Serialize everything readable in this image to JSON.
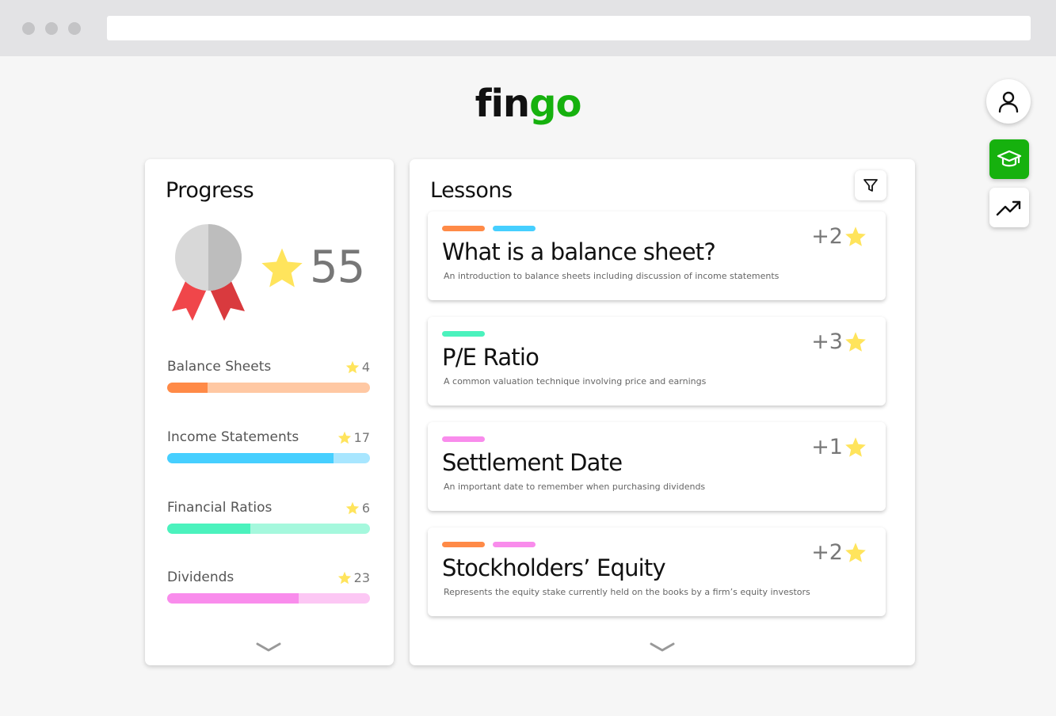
{
  "logo": {
    "part1": "fin",
    "part2": "go"
  },
  "icons": {
    "profile": "user-icon",
    "learn": "graduation-cap-icon",
    "trend": "trending-up-icon",
    "filter": "filter-icon",
    "star": "star-icon",
    "chevron": "chevron-down-icon"
  },
  "colors": {
    "brand_green": "#16b10e",
    "star": "#ffe45c",
    "balance": "#ff8a47",
    "income": "#46cfff",
    "ratios": "#4bf2bd",
    "dividends": "#f98cec"
  },
  "progress": {
    "title": "Progress",
    "score": "55",
    "categories": [
      {
        "label": "Balance Sheets",
        "count": "4",
        "fraction": 0.2,
        "color": "#ff8a47",
        "track": "#ffc8a3"
      },
      {
        "label": "Income Statements",
        "count": "17",
        "fraction": 0.82,
        "color": "#46cfff",
        "track": "#a8e6ff"
      },
      {
        "label": "Financial Ratios",
        "count": "6",
        "fraction": 0.41,
        "color": "#4bf2bd",
        "track": "#a5f8dd"
      },
      {
        "label": "Dividends",
        "count": "23",
        "fraction": 0.65,
        "color": "#f98cec",
        "track": "#fcc7f4"
      }
    ]
  },
  "lessons": {
    "title": "Lessons",
    "items": [
      {
        "title": "What is a balance sheet?",
        "description": "An introduction to balance sheets including discussion of income statements",
        "reward": "+2",
        "tags": [
          "#ff8a47",
          "#46cfff"
        ]
      },
      {
        "title": "P/E Ratio",
        "description": "A common valuation technique involving price and earnings",
        "reward": "+3",
        "tags": [
          "#4bf2bd"
        ]
      },
      {
        "title": "Settlement Date",
        "description": "An important date to remember when purchasing dividends",
        "reward": "+1",
        "tags": [
          "#f98cec"
        ]
      },
      {
        "title": "Stockholders’ Equity",
        "description": "Represents the equity stake currently held on the books by a firm’s equity investors",
        "reward": "+2",
        "tags": [
          "#ff8a47",
          "#f98cec"
        ]
      }
    ]
  }
}
